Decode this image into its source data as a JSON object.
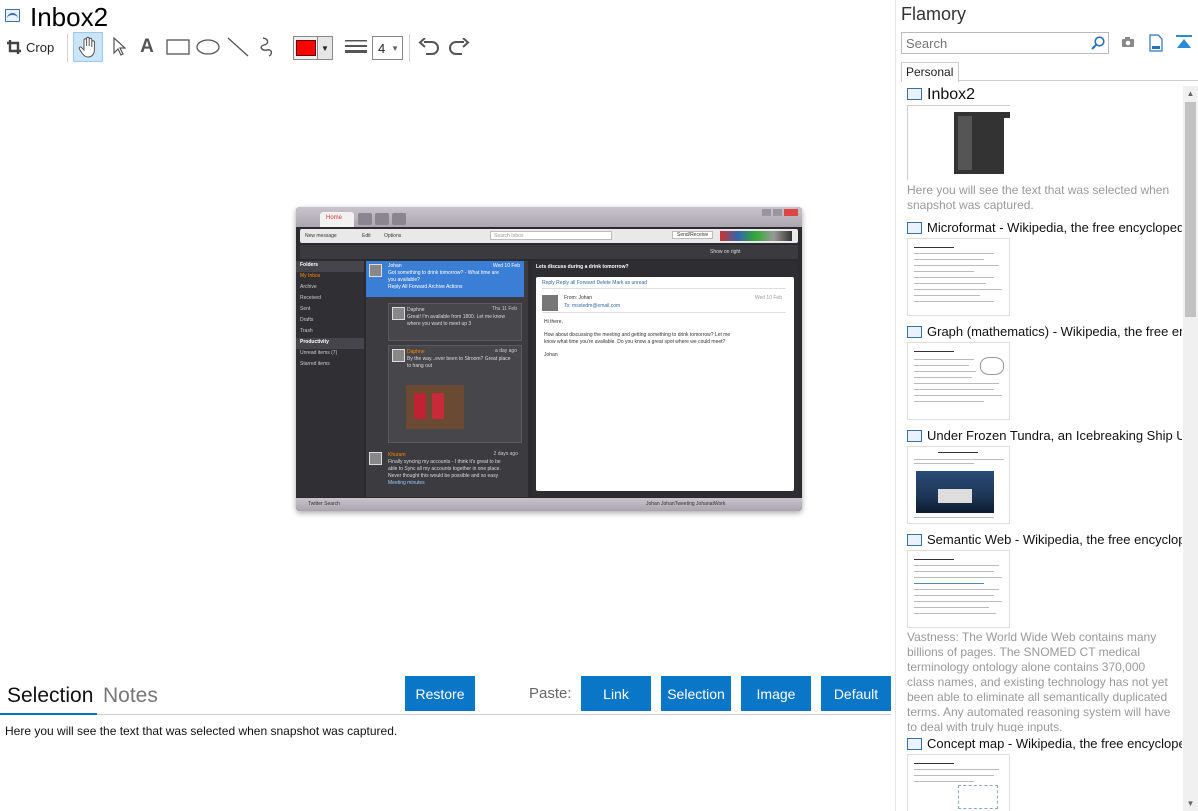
{
  "document": {
    "title": "Inbox2"
  },
  "toolbar": {
    "crop_label": "Crop",
    "line_width": "4",
    "color": "#ff0000"
  },
  "screenshot": {
    "tab_home": "Home",
    "menu": [
      "New message",
      "Edit",
      "Options",
      "Send/Receive"
    ],
    "search_placeholder": "Search Inbox",
    "show_on_right": "Show on right",
    "folders": [
      "Folders",
      "My Inbox",
      "Archive",
      "Received",
      "Sent",
      "Drafts",
      "Trash",
      "Productivity",
      "Unread items (7)",
      "Starred items"
    ],
    "selected_msg": {
      "from": "Johan",
      "date": "Wed 10 Feb",
      "text1": "Got something to drink tomorrow? - What time are",
      "text2": "you available?",
      "actions": "Reply All   Forward   Archive   Actions"
    },
    "msg2": {
      "from": "Daphne",
      "date": "Thu 11 Feb",
      "text1": "Great! I'm available from 1800. Let me know",
      "text2": "where you want to meet up 3"
    },
    "msg3": {
      "from": "Daphne",
      "date": "a day ago",
      "text1": "By the way...ever been to Stroom? Great place",
      "text2": "to hang out"
    },
    "msg4": {
      "from": "Khuram",
      "date": "2 days ago",
      "text1": "Finally syncing my accounts - I think it's great to be",
      "text2": "able to Sync all my accounts together in one place.",
      "text3": "Never thought this would be possible and so easy",
      "attach": "Meeting minutes"
    },
    "reading_title": "Lets discuss during a drink tomorrow?",
    "reading_actions": "Reply   Reply all   Forward   Delete   Mark as unread",
    "reading_from": "From:  Johan",
    "reading_to": "To:  msstedm@email.com",
    "reading_date": "Wed 10 Feb",
    "reading_body1": "Hi there,",
    "reading_body2": "How about discussing the meeting and getting something to drink tomorrow? Let me",
    "reading_body3": "know what time you're available. Do you know a great spot where we could meet?",
    "reading_body4": "Johan",
    "status_left": "Twitter Search",
    "status_right": "Johan   JohanTweeting   JohanatWork"
  },
  "bottom": {
    "tab_selection": "Selection",
    "tab_notes": "Notes",
    "restore": "Restore",
    "paste_label": "Paste:",
    "link": "Link",
    "selection": "Selection",
    "image": "Image",
    "default": "Default",
    "selected_text": "Here you will see the text that was selected when snapshot was captured."
  },
  "sidebar": {
    "brand": "Flamory",
    "search_placeholder": "Search",
    "tab": "Personal",
    "items": [
      {
        "title": "Inbox2",
        "desc": "Here you will see the text that was selected when snapshot was captured."
      },
      {
        "title": "Microformat - Wikipedia, the free encyclopedia"
      },
      {
        "title": "Graph (mathematics) - Wikipedia, the free ency"
      },
      {
        "title": "Under Frozen Tundra, an Icebreaking Ship Unco"
      },
      {
        "title": "Semantic Web - Wikipedia, the free encycloped",
        "desc": "Vastness: The World Wide Web contains many billions of pages. The SNOMED CT medical terminology ontology alone contains 370,000 class names, and existing technology has not yet been able to eliminate all semantically duplicated terms. Any automated reasoning system will have to deal with truly huge inputs."
      },
      {
        "title": "Concept map - Wikipedia, the free encyclopedia"
      }
    ]
  }
}
